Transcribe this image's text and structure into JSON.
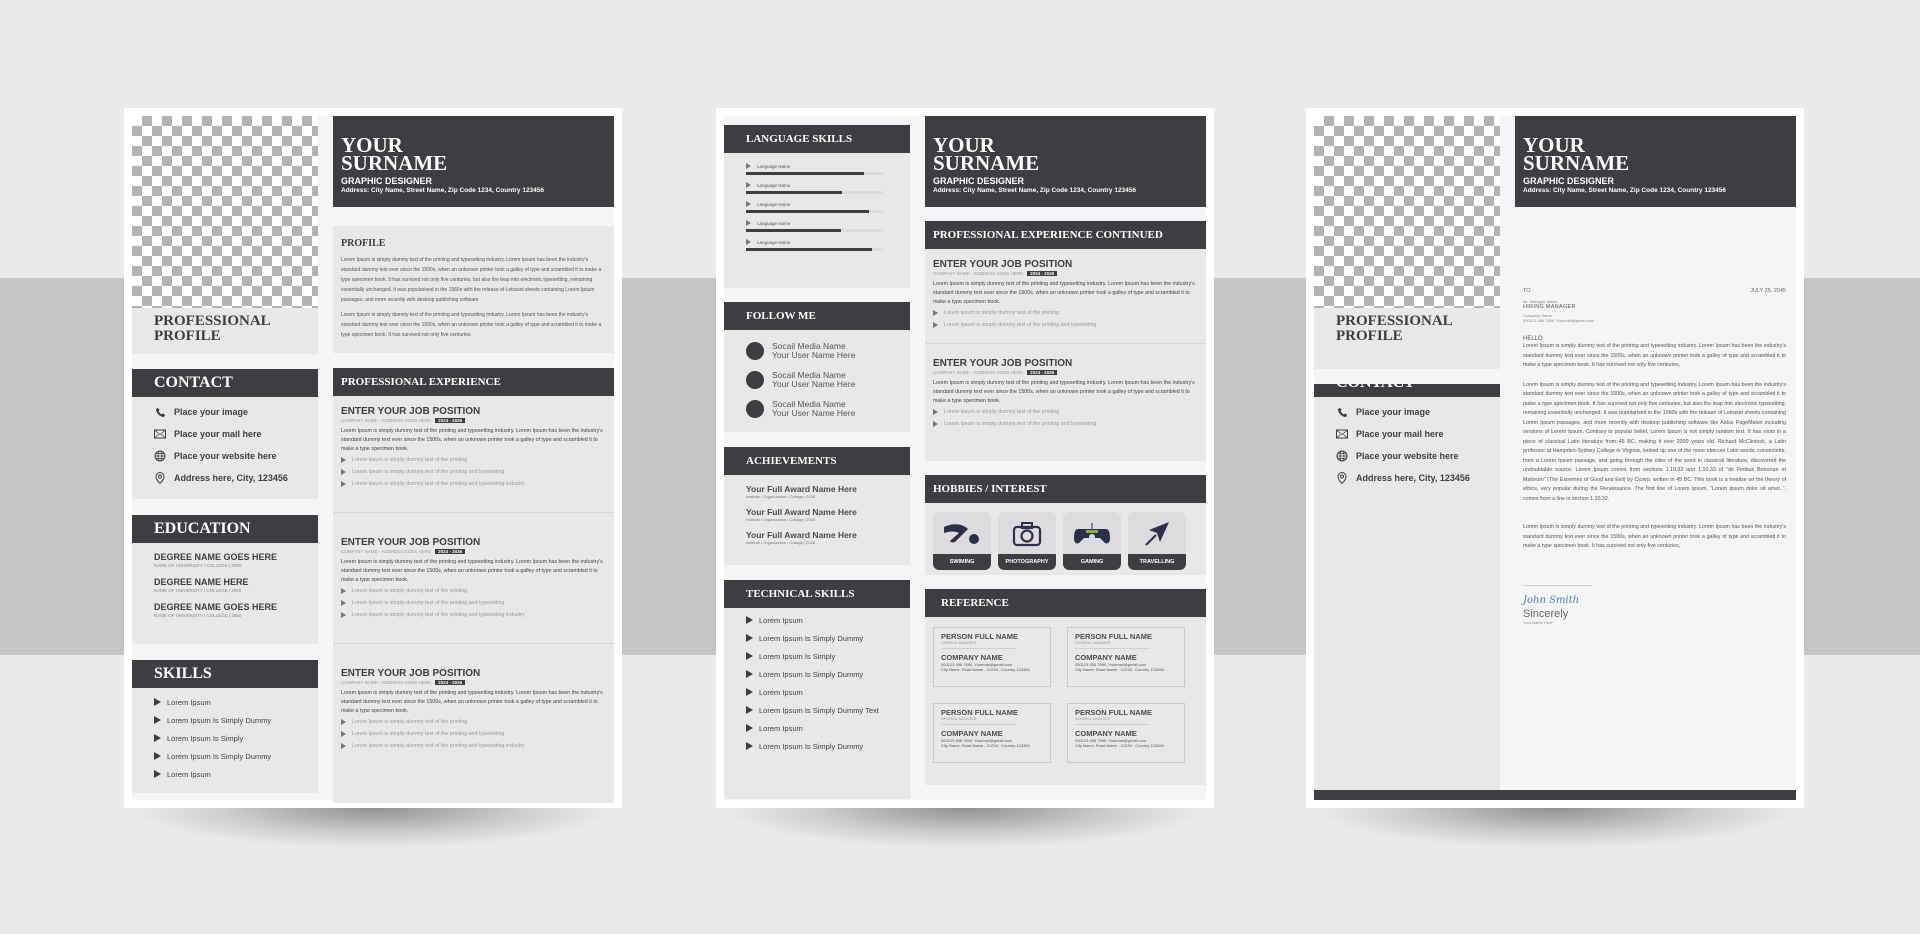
{
  "colors": {
    "dark": "#3d3e41",
    "panel": "#e8e8e8",
    "page_bg": "#f4f5f7",
    "backdrop": "#eaeaea",
    "band": "#c6c6c6",
    "signature": "#4a7fb8"
  },
  "header": {
    "name_line1": "YOUR",
    "name_line2": "SURNAME",
    "role": "GRAPHIC DESIGNER",
    "address": "Address: City Name, Street Name, Zip Code 1234, Country 123456"
  },
  "left_page": {
    "photo_placeholder": "transparent-checkerboard",
    "professional_profile": [
      "PROFESSIONAL",
      "PROFILE"
    ],
    "contact": {
      "title": "CONTACT",
      "items": [
        {
          "icon": "phone-icon",
          "text": "Place your image"
        },
        {
          "icon": "mail-icon",
          "text": "Place your mail here"
        },
        {
          "icon": "globe-icon",
          "text": "Place your website here"
        },
        {
          "icon": "location-pin-icon",
          "text": "Address here, City, 123456"
        }
      ]
    },
    "education": {
      "title": "EDUCATION",
      "items": [
        {
          "degree": "DEGREE NAME GOES HERE",
          "school": "NAME OF UNIVERSITY / COLLEGE | 2050"
        },
        {
          "degree": "DEGREE NAME HERE",
          "school": "NAME OF UNIVERSITY / COLLEGE | 2050"
        },
        {
          "degree": "DEGREE NAME GOES HERE",
          "school": "NAME OF UNIVERSITY / COLLEGE | 2050"
        }
      ]
    },
    "skills": {
      "title": "SKILLS",
      "items": [
        "Lorem Ipsum",
        "Lorem Ipsum Is Simply Dummy",
        "Lorem Ipsum Is Simply",
        "Lorem Ipsum Is Simply Dummy",
        "Lorem Ipsum"
      ]
    },
    "profile": {
      "title": "PROFILE",
      "paragraphs": [
        "Lorem Ipsum is simply dummy text of the printing and typesetting industry. Lorem Ipsum has been the industry's standard dummy text ever since the 1500s, when an unknown printer took a galley of type and scrambled it to make a type specimen book. It has survived not only five centuries, but also the leap into electronic typesetting, remaining essentially unchanged. It was popularised in the 1960s with the release of Letraset sheets containing Lorem Ipsum passages, and more recently with desktop publishing software",
        "Lorem Ipsum is simply dummy text of the printing and typesetting industry. Lorem Ipsum has been the industry's standard dummy text ever since the 1500s, when an unknown printer took a galley of type and scrambled it to make a type specimen book. It has survived not only five centuries."
      ]
    },
    "experience": {
      "title": "PROFESSIONAL EXPERIENCE",
      "jobs": [
        {
          "position": "ENTER YOUR JOB POSITION",
          "company": "COMPANY NAME - ADDRESS GOES HERE",
          "dates": "2024 - 2026",
          "desc": "Lorem Ipsum is simply dummy text of the printing and typesetting industry. Lorem Ipsum has been the industry's standard dummy text ever since the 1500s, when an unknown printer took a galley of type and scrambled it to make a type specimen book.",
          "bullets": [
            "Lorem Ipsum is simply dummy text of the printing",
            "Lorem Ipsum is simply dummy text of the printing and typesetting",
            "Lorem Ipsum is simply dummy text of the printing and typesetting industry"
          ]
        },
        {
          "position": "ENTER YOUR JOB POSITION",
          "company": "COMPANY NAME - ADDRESS GOES HERE",
          "dates": "2024 - 2026",
          "desc": "Lorem Ipsum is simply dummy text of the printing and typesetting industry. Lorem Ipsum has been the industry's standard dummy text ever since the 1500s, when an unknown printer took a galley of type and scrambled it to make a type specimen book.",
          "bullets": [
            "Lorem Ipsum is simply dummy text of the printing",
            "Lorem Ipsum is simply dummy text of the printing and typesetting",
            "Lorem Ipsum is simply dummy text of the printing and typesetting industry"
          ]
        },
        {
          "position": "ENTER YOUR JOB POSITION",
          "company": "COMPANY NAME - ADDRESS GOES HERE",
          "dates": "2024 - 2026",
          "desc": "Lorem Ipsum is simply dummy text of the printing and typesetting industry. Lorem Ipsum has been the industry's standard dummy text ever since the 1500s, when an unknown printer took a galley of type and scrambled it to make a type specimen book.",
          "bullets": [
            "Lorem Ipsum is simply dummy text of the printing",
            "Lorem Ipsum is simply dummy text of the printing and typesetting",
            "Lorem Ipsum is simply dummy text of the printing and typesetting industry"
          ]
        }
      ]
    }
  },
  "middle_page": {
    "languages": {
      "title": "LANGUAGE SKILLS",
      "items": [
        {
          "name": "Language Name",
          "level": 0.86
        },
        {
          "name": "Language Name",
          "level": 0.7
        },
        {
          "name": "Language Name",
          "level": 0.9
        },
        {
          "name": "Language Name",
          "level": 0.69
        },
        {
          "name": "Language Name",
          "level": 0.92
        }
      ]
    },
    "follow": {
      "title": "FOLLOW ME",
      "items": [
        {
          "network": "Socail Media Name",
          "user": "Your User Name Here"
        },
        {
          "network": "Socail Media Name",
          "user": "Your User Name Here"
        },
        {
          "network": "Socail Media Name",
          "user": "Your User Name Here"
        }
      ]
    },
    "achievements": {
      "title": "ACHIEVEMENTS",
      "items": [
        {
          "award": "Your Full Award Name Here",
          "org": "Institute / Organization / Collage | 2026"
        },
        {
          "award": "Your Full Award Name Here",
          "org": "Institute / Organization / Collage | 2026"
        },
        {
          "award": "Your Full Award Name Here",
          "org": "Institute / Organization / Collage | 2026"
        }
      ]
    },
    "technical": {
      "title": "TECHNICAL SKILLS",
      "items": [
        "Lorem Ipsum",
        "Lorem Ipsum Is Simply Dummy",
        "Lorem Ipsum Is Simply",
        "Lorem Ipsum Is Simply Dummy",
        "Lorem Ipsum",
        "Lorem Ipsum Is Simply Dummy Text",
        "Lorem Ipsum",
        "Lorem Ipsum Is Simply Dummy"
      ]
    },
    "experience_cont": {
      "title": "PROFESSIONAL EXPERIENCE CONTINUED",
      "jobs": [
        {
          "position": "ENTER YOUR JOB POSITION",
          "company": "COMPANY NAME - ADDRESS GOES HERE",
          "dates": "2024 - 2026",
          "desc": "Lorem Ipsum is simply dummy text of the printing and typesetting industry. Lorem Ipsum has been the industry's standard dummy text ever since the 1500s, when an unknown printer took a galley of type and scrambled it to make a type specimen book.",
          "bullets": [
            "Lorem Ipsum is simply dummy text of the printing",
            "Lorem Ipsum is simply dummy text of the printing and typesetting"
          ]
        },
        {
          "position": "ENTER YOUR JOB POSITION",
          "company": "COMPANY NAME - ADDRESS GOES HERE",
          "dates": "2024 - 2026",
          "desc": "Lorem Ipsum is simply dummy text of the printing and typesetting industry. Lorem Ipsum has been the industry's standard dummy text ever since the 1500s, when an unknown printer took a galley of type and scrambled it to make a type specimen book.",
          "bullets": [
            "Lorem Ipsum is simply dummy text of the printing",
            "Lorem Ipsum is simply dummy text of the printing and typesetting"
          ]
        }
      ]
    },
    "hobbies": {
      "title": "HOBBIES / INTEREST",
      "items": [
        {
          "icon": "swimming-icon",
          "label": "SWIMING"
        },
        {
          "icon": "camera-icon",
          "label": "PHOTOGRAPHY"
        },
        {
          "icon": "gamepad-icon",
          "label": "GAMING"
        },
        {
          "icon": "navigation-arrow-icon",
          "label": "TRAVELLING"
        }
      ]
    },
    "reference": {
      "title": "REFERENCE",
      "items": [
        {
          "name": "PERSON FULL NAME",
          "title": "GENERAL MANAGER",
          "company": "COMPANY NAME",
          "contact": "000123 456 7890, Yourmail@gmail.com",
          "address": "City Name, Road Name - 01234 , Country 123456"
        },
        {
          "name": "PERSON FULL NAME",
          "title": "GENERAL MANAGER",
          "company": "COMPANY NAME",
          "contact": "000123 456 7890, Yourmail@gmail.com",
          "address": "City Name, Road Name - 01234 , Country 123456"
        },
        {
          "name": "PERSON FULL NAME",
          "title": "GENERAL MANAGER",
          "company": "COMPANY NAME",
          "contact": "000123 456 7890, Yourmail@gmail.com",
          "address": "City Name, Road Name - 01234 , Country 123456"
        },
        {
          "name": "PERSON FULL NAME",
          "title": "GENERAL MANAGER",
          "company": "COMPANY NAME",
          "contact": "000123 456 7890, Yourmail@gmail.com",
          "address": "City Name, Road Name - 01234 , Country 123456"
        }
      ]
    }
  },
  "right_page": {
    "letter": {
      "to_label": "TO",
      "date": "JULY 25, 2045",
      "recipient_name": "Mr. Manager Name",
      "recipient_title": "HIRING MANAGER",
      "company": "Company Name",
      "company_contact": "000123 456 7890, Yourmail@gmail.com",
      "greeting": "HELLO",
      "paragraphs": [
        "Lorem Ipsum is simply dummy text of the printing and typesetting industry. Lorem Ipsum has been the industry's standard dummy text ever since the 1500s, when an unknown printer took a galley of type and scrambled it to make a type specimen book. It has survived not only five centuries,",
        "Lorem Ipsum is simply dummy text of the printing and typesetting industry. Lorem Ipsum has been the industry's standard dummy text ever since the 1500s, when an unknown printer took a galley of type and scrambled it to make a type specimen book. It has survived not only five centuries, but also the leap into electronic typesetting, remaining essentially unchanged. It was popularised in the 1960s with the release of Letraset sheets containing Lorem Ipsum passages, and more recently with desktop publishing software like Aldus PageMaker including versions of Lorem Ipsum. Contrary to popular belief, Lorem Ipsum is not simply random text. It has roots in a piece of classical Latin literature from 45 BC, making it over 2000 years old. Richard McClintock, a Latin professor at Hampden-Sydney College in Virginia, looked up one of the more obscure Latin words, consectetur, from a Lorem Ipsum passage, and going through the cites of the word in classical literature, discovered the undoubtable source. Lorem Ipsum comes from sections 1.10.32 and 1.10.33 of \"de Finibus Bonorum et Malorum\" (The Extremes of Good and Evil) by Cicero, written in 45 BC. This book is a treatise on the theory of ethics, very popular during the Renaissance. The first line of Lorem Ipsum, \"Lorem ipsum dolor sit amet..\", comes from a line in section 1.10.32.",
        "Lorem Ipsum is simply dummy text of the printing and typesetting industry. Lorem Ipsum has been the industry's standard dummy text ever since the 1500s, when an unknown printer took a galley of type and scrambled it to make a type specimen book. It has survived not only five centuries,"
      ],
      "signature": "John Smith",
      "closing": "Sincerely",
      "your_name": "Your Name Here"
    }
  }
}
